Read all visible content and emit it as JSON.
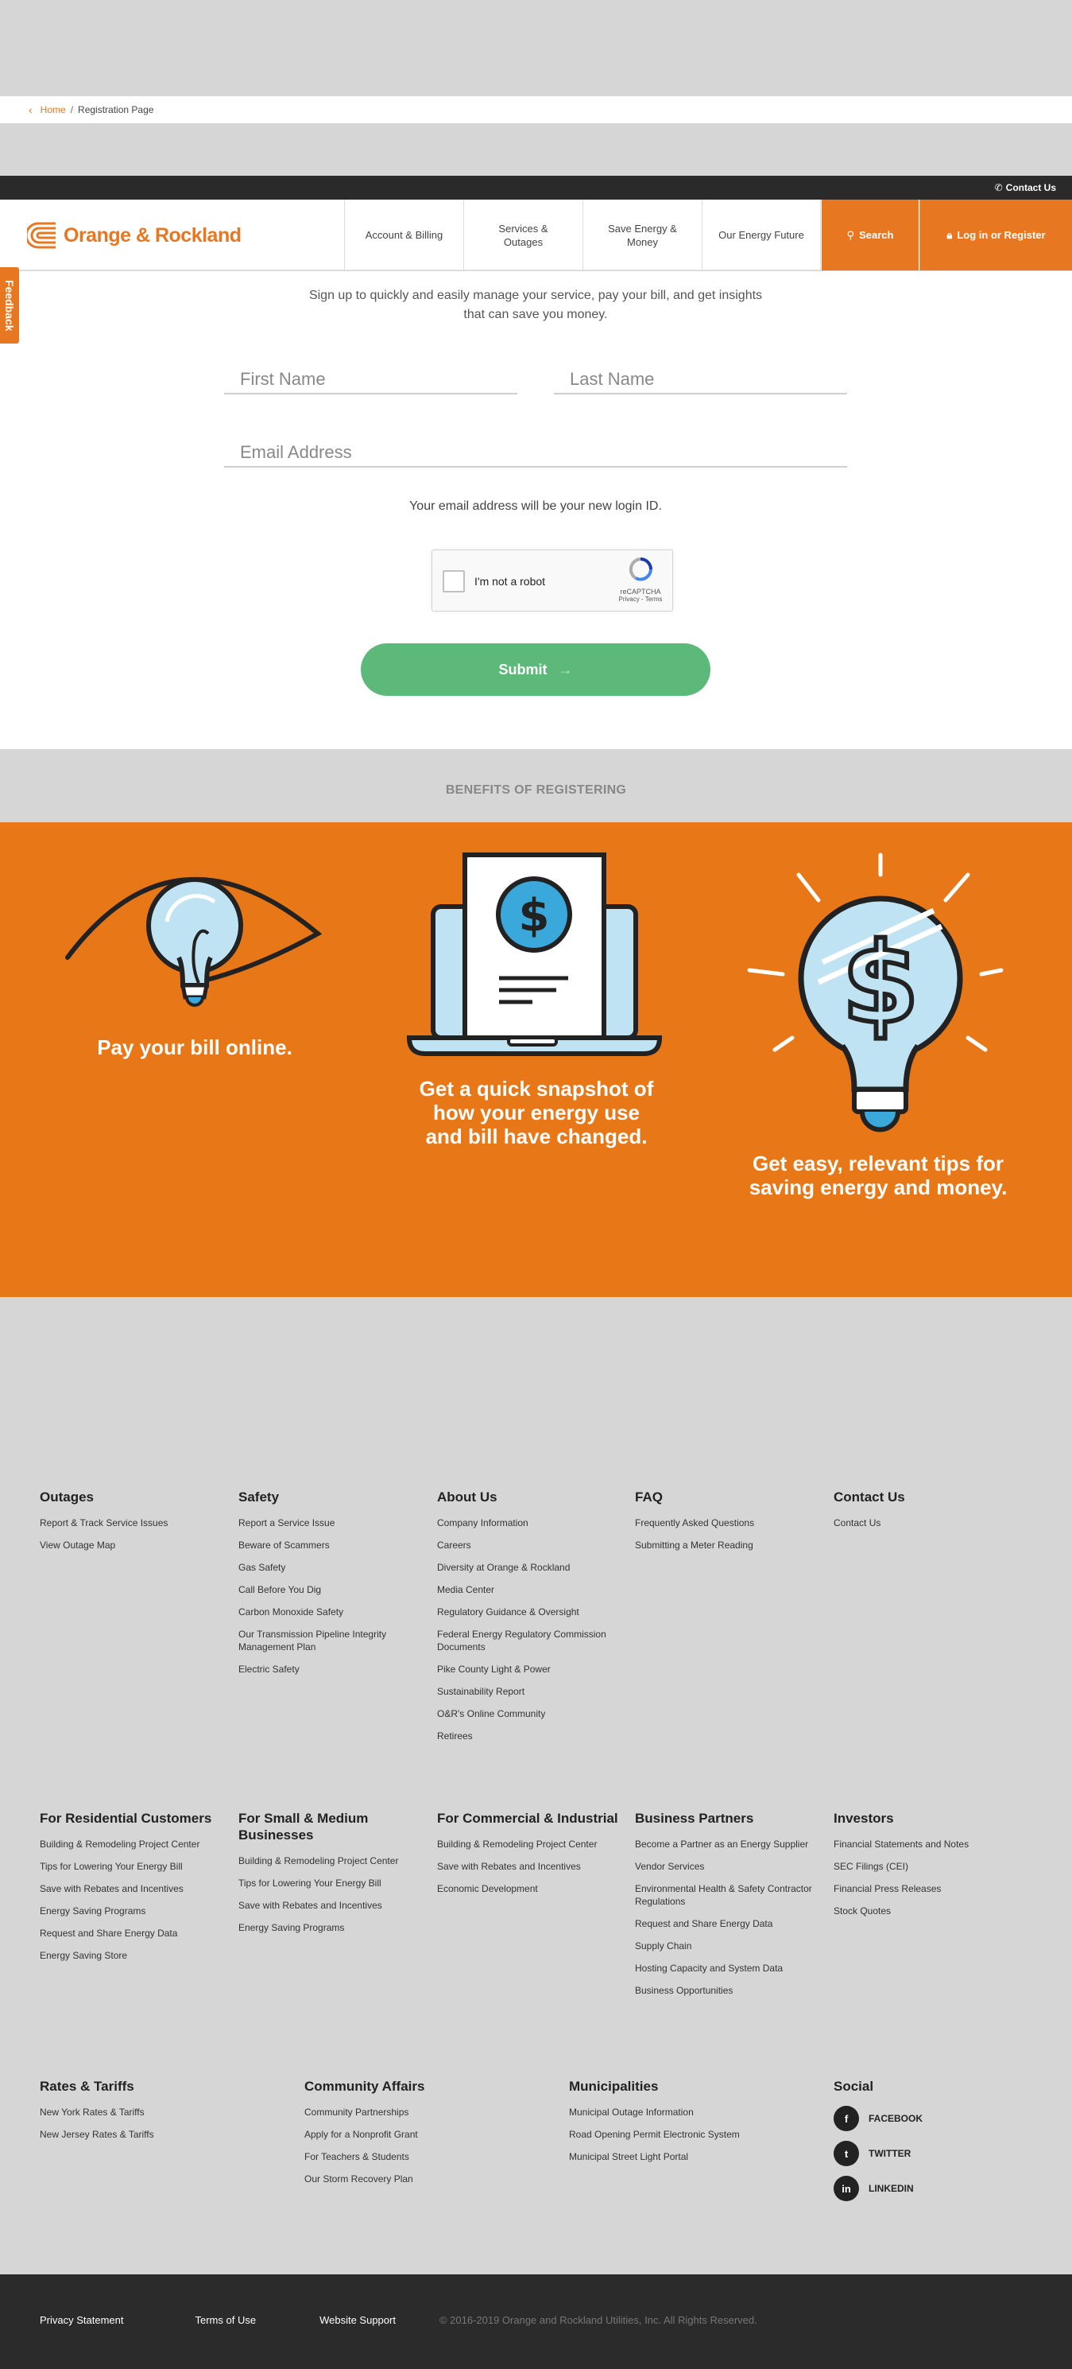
{
  "breadcrumb": {
    "home": "Home",
    "separator": "/",
    "current": "Registration Page"
  },
  "utility": {
    "contact": "Contact Us"
  },
  "header": {
    "logo": "Orange & Rockland",
    "nav": [
      "Account & Billing",
      "Services & Outages",
      "Save Energy & Money",
      "Our Energy Future"
    ],
    "search": "Search",
    "login": "Log in or Register"
  },
  "feedback": "Feedback",
  "form": {
    "intro": "Sign up to quickly and easily manage your service, pay your bill, and get insights that can save you money.",
    "first_name_placeholder": "First Name",
    "last_name_placeholder": "Last Name",
    "email_placeholder": "Email Address",
    "note": "Your email address will be your new login ID.",
    "captcha_label": "I'm not a robot",
    "captcha_brand": "reCAPTCHA",
    "captcha_links": "Privacy - Terms",
    "submit": "Submit"
  },
  "benefits": {
    "title": "BENEFITS OF REGISTERING",
    "items": [
      "Pay your bill online.",
      "Get a quick snapshot of how your energy use and bill have changed.",
      "Get easy, relevant tips for saving energy and money."
    ]
  },
  "colors": {
    "brand_orange": "#e87722",
    "submit_green": "#5cb97a",
    "icon_blue": "#3aa8db",
    "dark": "#2b2b2b"
  },
  "footer": {
    "row1": [
      {
        "title": "Outages",
        "links": [
          "Report & Track Service Issues",
          "View Outage Map"
        ]
      },
      {
        "title": "Safety",
        "links": [
          "Report a Service Issue",
          "Beware of Scammers",
          "Gas Safety",
          "Call Before You Dig",
          "Carbon Monoxide Safety",
          "Our Transmission Pipeline Integrity Management Plan",
          "Electric Safety"
        ]
      },
      {
        "title": "About Us",
        "links": [
          "Company Information",
          "Careers",
          "Diversity at Orange & Rockland",
          "Media Center",
          "Regulatory Guidance & Oversight",
          "Federal Energy Regulatory Commission Documents",
          "Pike County Light & Power",
          "Sustainability Report",
          "O&R's Online Community",
          "Retirees"
        ]
      },
      {
        "title": "FAQ",
        "links": [
          "Frequently Asked Questions",
          "Submitting a Meter Reading"
        ]
      },
      {
        "title": "Contact Us",
        "links": [
          "Contact Us"
        ]
      }
    ],
    "row2": [
      {
        "title": "For Residential Customers",
        "links": [
          "Building & Remodeling Project Center",
          "Tips for Lowering Your Energy Bill",
          "Save with Rebates and Incentives",
          "Energy Saving Programs",
          "Request and Share Energy Data",
          "Energy Saving Store"
        ]
      },
      {
        "title": "For Small & Medium Businesses",
        "links": [
          "Building & Remodeling Project Center",
          "Tips for Lowering Your Energy Bill",
          "Save with Rebates and Incentives",
          "Energy Saving Programs"
        ]
      },
      {
        "title": "For Commercial & Industrial",
        "links": [
          "Building & Remodeling Project Center",
          "Save with Rebates and Incentives",
          "Economic Development"
        ]
      },
      {
        "title": "Business Partners",
        "links": [
          "Become a Partner as an Energy Supplier",
          "Vendor Services",
          "Environmental Health & Safety Contractor Regulations",
          "Request and Share Energy Data",
          "Supply Chain",
          "Hosting Capacity and System Data",
          "Business Opportunities"
        ]
      },
      {
        "title": "Investors",
        "links": [
          "Financial Statements and Notes",
          "SEC Filings (CEI)",
          "Financial Press Releases",
          "Stock Quotes"
        ]
      }
    ],
    "row3": [
      {
        "title": "Rates & Tariffs",
        "links": [
          "New York Rates & Tariffs",
          "New Jersey Rates & Tariffs"
        ]
      },
      {
        "title": "Community Affairs",
        "links": [
          "Community Partnerships",
          "Apply for a Nonprofit Grant",
          "For Teachers & Students",
          "Our Storm Recovery Plan"
        ]
      },
      {
        "title": "Municipalities",
        "links": [
          "Municipal Outage Information",
          "Road Opening Permit Electronic System",
          "Municipal Street Light Portal"
        ]
      }
    ],
    "social": {
      "title": "Social",
      "items": [
        {
          "icon": "facebook-icon",
          "glyph": "f",
          "label": "FACEBOOK"
        },
        {
          "icon": "twitter-icon",
          "glyph": "t",
          "label": "TWITTER"
        },
        {
          "icon": "linkedin-icon",
          "glyph": "in",
          "label": "LINKEDIN"
        }
      ]
    },
    "bottom": {
      "privacy": "Privacy Statement",
      "terms": "Terms of Use",
      "support": "Website Support",
      "copyright": "© 2016-2019 Orange and Rockland Utilities, Inc. All Rights Reserved."
    }
  }
}
